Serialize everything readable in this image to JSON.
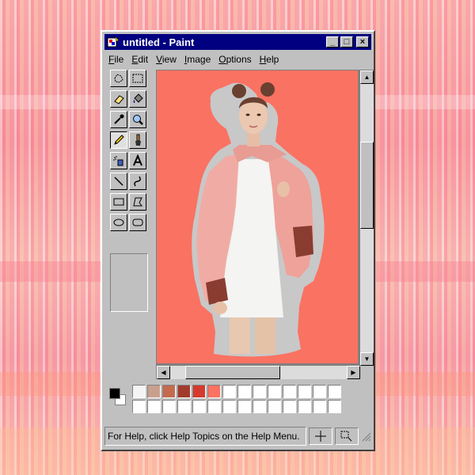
{
  "window": {
    "title": "untitled - Paint",
    "minimize_glyph": "_",
    "maximize_glyph": "□",
    "close_glyph": "×"
  },
  "menu": [
    "File",
    "Edit",
    "View",
    "Image",
    "Options",
    "Help"
  ],
  "tools": [
    "free-form-select",
    "select",
    "eraser",
    "fill-with-color",
    "pick-color",
    "magnifier",
    "pencil",
    "brush",
    "airbrush",
    "text",
    "line",
    "curve",
    "rectangle",
    "polygon",
    "ellipse",
    "rounded-rectangle"
  ],
  "active_tool": "pencil",
  "canvas": {
    "background_color": "#fa7262",
    "image": "photo-of-woman-in-pink-jacket"
  },
  "colors": {
    "foreground": "#000000",
    "background": "#ffffff",
    "palette_row1": [
      "#f4f4f4",
      "#c9a08e",
      "#c56a4f",
      "#a33b2c",
      "#d43b2c",
      "#fa7262",
      "#ffffff",
      "#ffffff",
      "#ffffff",
      "#ffffff",
      "#ffffff",
      "#ffffff",
      "#ffffff",
      "#ffffff"
    ],
    "palette_row2": [
      "#ffffff",
      "#ffffff",
      "#ffffff",
      "#ffffff",
      "#ffffff",
      "#ffffff",
      "#ffffff",
      "#ffffff",
      "#ffffff",
      "#ffffff",
      "#ffffff",
      "#ffffff",
      "#ffffff",
      "#ffffff"
    ]
  },
  "status": {
    "help_text": "For Help, click Help Topics on the Help Menu."
  }
}
